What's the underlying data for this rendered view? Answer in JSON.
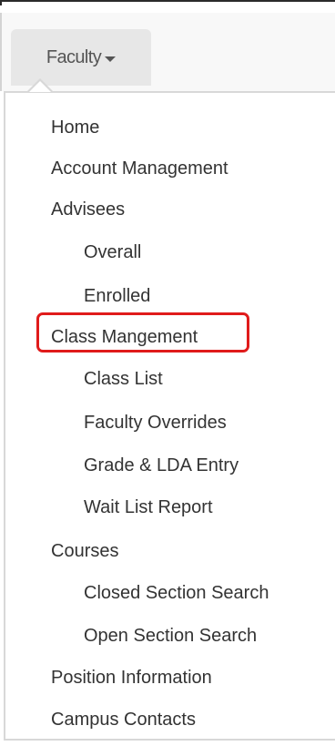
{
  "nav": {
    "faculty_label": "Faculty"
  },
  "menu": {
    "items": [
      {
        "label": "Home",
        "level": 0
      },
      {
        "label": "Account Management",
        "level": 0
      },
      {
        "label": "Advisees",
        "level": 0
      },
      {
        "label": "Overall",
        "level": 1
      },
      {
        "label": "Enrolled",
        "level": 1
      },
      {
        "label": "Class Mangement",
        "level": 0,
        "highlighted": true
      },
      {
        "label": "Class List",
        "level": 1
      },
      {
        "label": "Faculty Overrides",
        "level": 1
      },
      {
        "label": "Grade & LDA Entry",
        "level": 1
      },
      {
        "label": "Wait List Report",
        "level": 1
      },
      {
        "label": "Courses",
        "level": 0
      },
      {
        "label": "Closed Section Search",
        "level": 1
      },
      {
        "label": "Open Section Search",
        "level": 1
      },
      {
        "label": "Position Information",
        "level": 0
      },
      {
        "label": "Campus Contacts",
        "level": 0
      }
    ]
  },
  "colors": {
    "highlight": "#e01b1b",
    "button_bg": "#e7e7e7",
    "text": "#333333"
  },
  "icons": {
    "caret": "caret-down-icon"
  }
}
